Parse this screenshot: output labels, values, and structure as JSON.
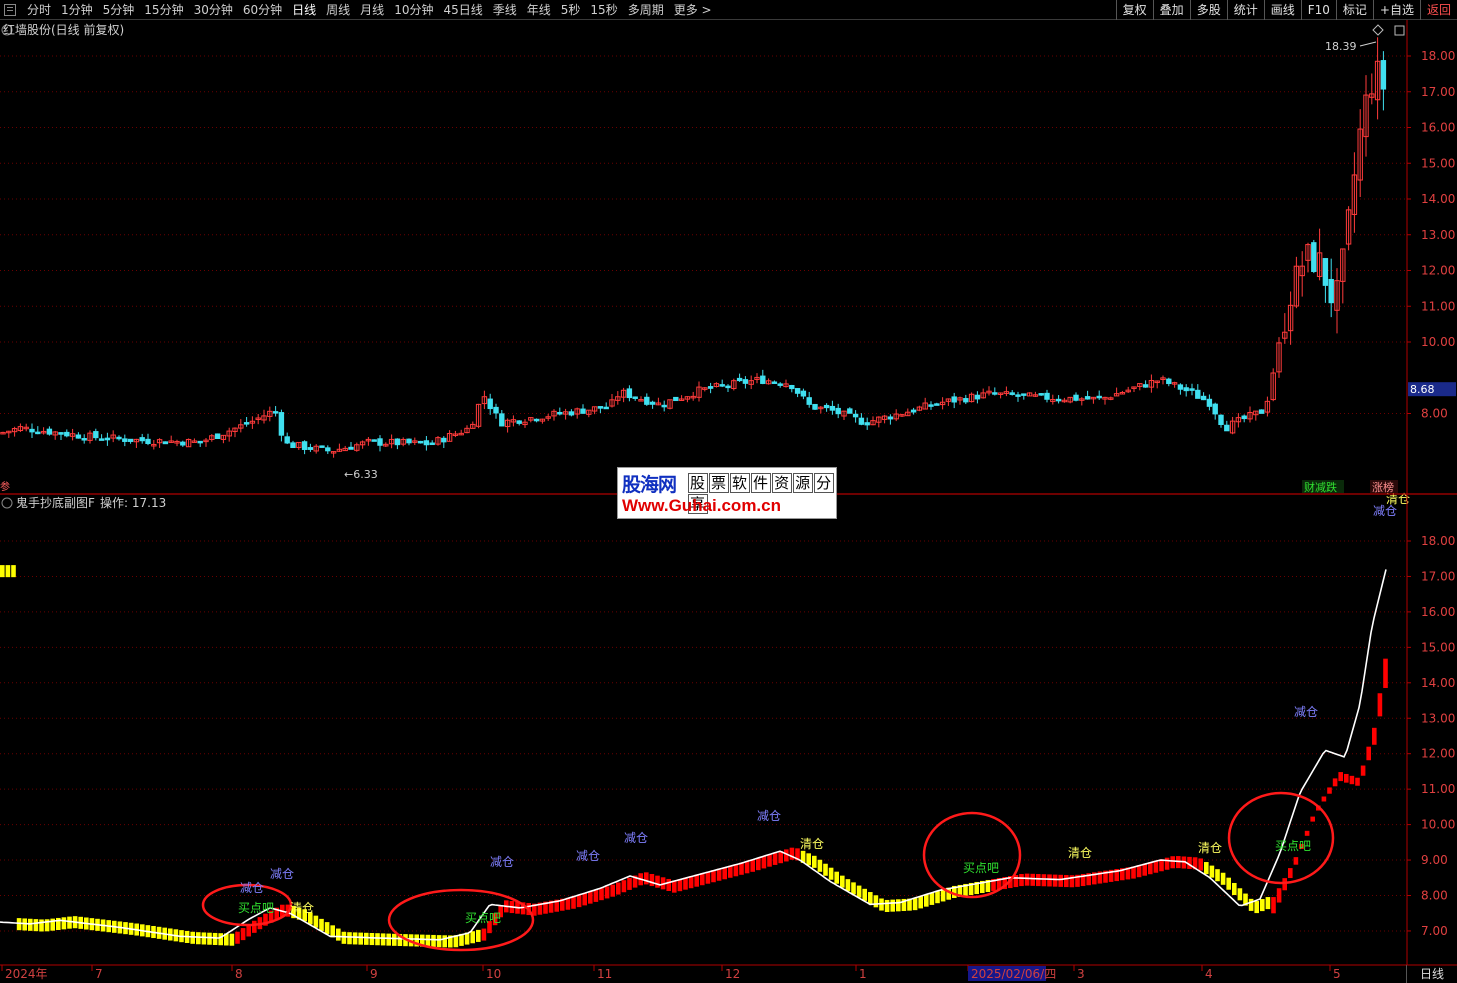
{
  "toolbar": {
    "periods": [
      "分时",
      "1分钟",
      "5分钟",
      "15分钟",
      "30分钟",
      "60分钟",
      "日线",
      "周线",
      "月线",
      "10分钟",
      "45日线",
      "季线",
      "年线",
      "5秒",
      "15秒",
      "多周期",
      "更多 >"
    ],
    "active_period": "日线",
    "actions": [
      "复权",
      "叠加",
      "多股",
      "统计",
      "画线",
      "F10",
      "标记",
      "+自选",
      "返回"
    ]
  },
  "main_panel": {
    "title": "红墙股份(日线 前复权)",
    "max_label": "18.39",
    "min_label": "6.33",
    "current_price": "8.68",
    "y_ticks": [
      "18.00",
      "17.00",
      "16.00",
      "15.00",
      "14.00",
      "13.00",
      "12.00",
      "11.00",
      "10.00",
      "8.00"
    ],
    "badges": [
      "财减跌",
      "涨榜"
    ],
    "side_label": "参"
  },
  "indicator_panel": {
    "title": "鬼手抄底副图F",
    "value_text": "操作: 17.13",
    "y_ticks": [
      "18.00",
      "17.00",
      "16.00",
      "15.00",
      "14.00",
      "13.00",
      "12.00",
      "11.00",
      "10.00",
      "9.00",
      "8.00",
      "7.00"
    ],
    "signals": {
      "buy": "买点吧",
      "reduce": "减仓",
      "clear": "清仓"
    }
  },
  "x_axis": {
    "labels": [
      "2024年",
      "7",
      "8",
      "9",
      "10",
      "11",
      "12",
      "1",
      "2025/02/06/四",
      "3",
      "4",
      "5"
    ],
    "period": "日线"
  },
  "watermark": {
    "brand": "股海网",
    "slogan": [
      "股",
      "票",
      "软",
      "件",
      "资",
      "源",
      "分",
      "享"
    ],
    "url": "Www.Guhai.com.cn"
  },
  "colors": {
    "up": "#ff3b3b",
    "down": "#40e0f0",
    "grid": "#6a0000",
    "axis": "#b00000",
    "yellow_bar": "#ffff00",
    "red_bar": "#ff0000",
    "white_line": "#ffffff",
    "buy_text": "#30e030",
    "reduce_text": "#8080ff",
    "clear_text": "#ffff60"
  },
  "chart_data": [
    {
      "type": "candlestick",
      "title": "红墙股份(日线 前复权)",
      "ylim": [
        7.1,
        18.7
      ],
      "close_profile": {
        "months": [
          "2024-06",
          "2024-07",
          "2024-08",
          "2024-09",
          "2024-10",
          "2024-11",
          "2024-12",
          "2025-01",
          "2025-02",
          "2025-03",
          "2025-04",
          "2025-05"
        ],
        "approx_close": [
          7.5,
          7.2,
          7.5,
          7.1,
          7.8,
          8.2,
          8.7,
          8.0,
          8.5,
          8.5,
          8.0,
          17.0
        ]
      },
      "annotated_high": 18.39,
      "annotated_low": 6.33,
      "last": 8.68
    },
    {
      "type": "bar",
      "title": "鬼手抄底副图F",
      "ylim": [
        6.3,
        19.0
      ],
      "value_label": 17.13,
      "signal_sequence": [
        "减仓",
        "买点吧",
        "清仓",
        "买点吧",
        "减仓",
        "减仓",
        "减仓",
        "减仓",
        "清仓",
        "买点吧",
        "清仓",
        "清仓",
        "买点吧",
        "减仓",
        "减仓",
        "清仓"
      ]
    }
  ]
}
